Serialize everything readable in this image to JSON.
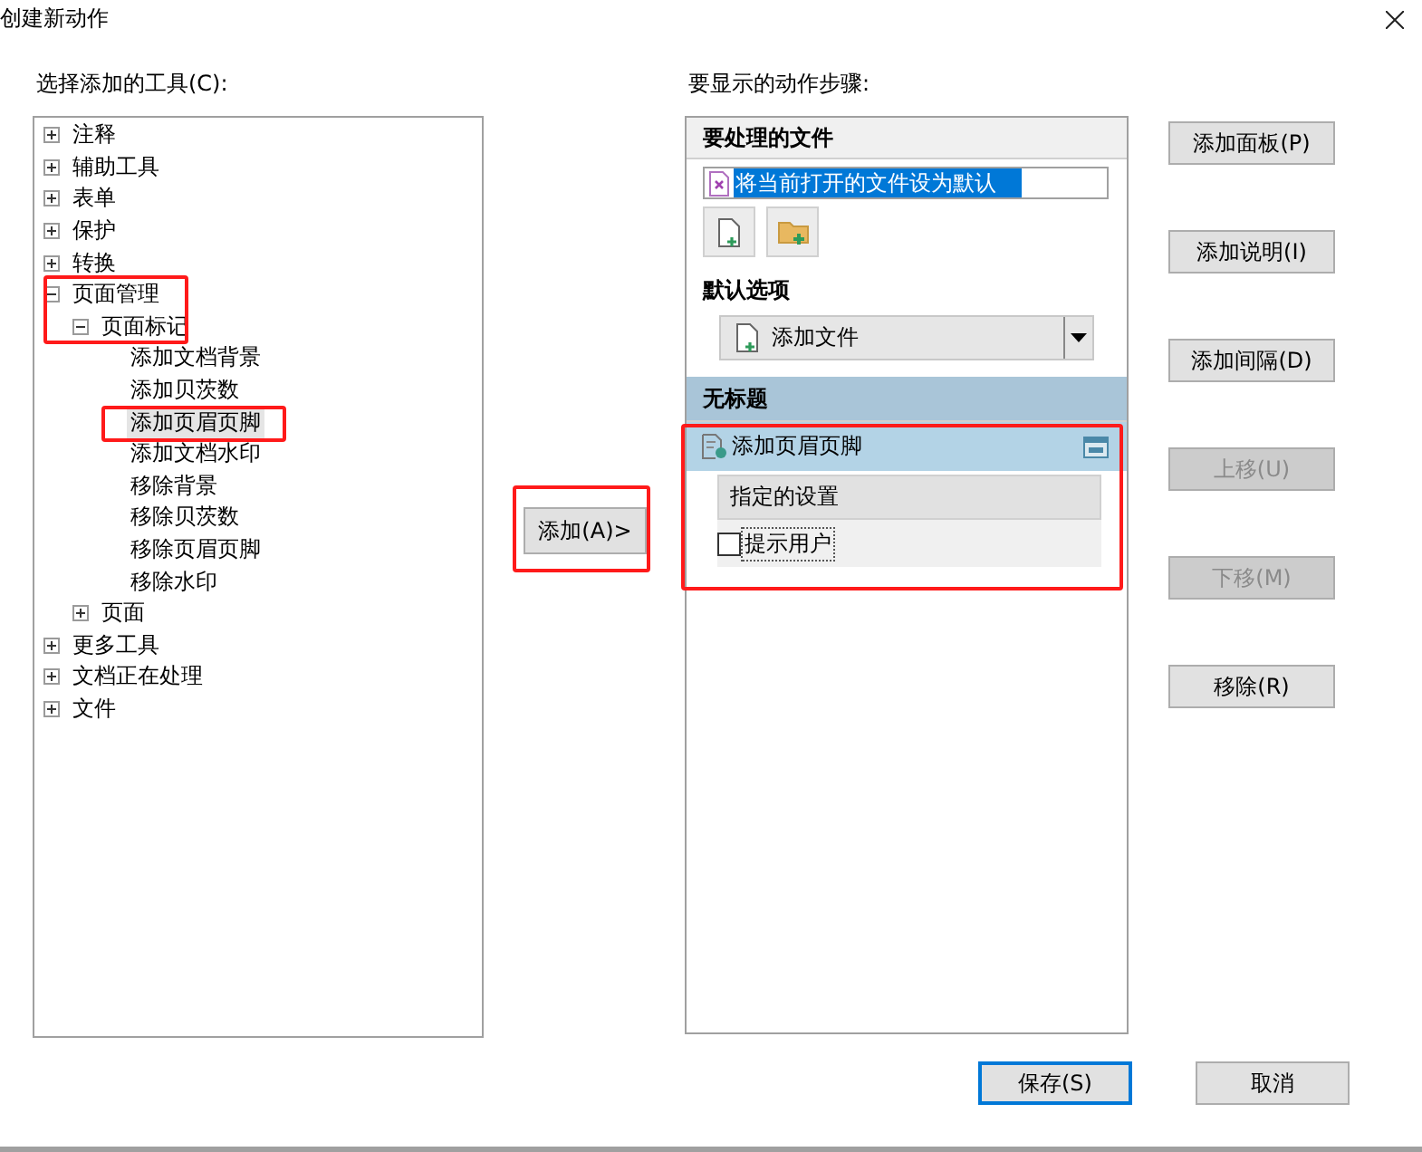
{
  "window": {
    "title": "创建新动作"
  },
  "tools_label": "选择添加的工具(C):",
  "tree": [
    {
      "label": "注释",
      "expanded": false
    },
    {
      "label": "辅助工具",
      "expanded": false
    },
    {
      "label": "表单",
      "expanded": false
    },
    {
      "label": "保护",
      "expanded": false
    },
    {
      "label": "转换",
      "expanded": false
    },
    {
      "label": "页面管理",
      "expanded": true,
      "children": [
        {
          "label": "页面标记",
          "expanded": true,
          "children": [
            {
              "label": "添加文档背景",
              "selected": false
            },
            {
              "label": "添加贝茨数",
              "selected": false
            },
            {
              "label": "添加页眉页脚",
              "selected": true
            },
            {
              "label": "添加文档水印",
              "selected": false
            },
            {
              "label": "移除背景",
              "selected": false
            },
            {
              "label": "移除贝茨数",
              "selected": false
            },
            {
              "label": "移除页眉页脚",
              "selected": false
            },
            {
              "label": "移除水印",
              "selected": false
            }
          ]
        },
        {
          "label": "页面",
          "expanded": false
        }
      ]
    },
    {
      "label": "更多工具",
      "expanded": false
    },
    {
      "label": "文档正在处理",
      "expanded": false
    },
    {
      "label": "文件",
      "expanded": false
    }
  ],
  "add_button": "添加(A)>",
  "steps_label": "要显示的动作步骤:",
  "file_section": {
    "title": "要处理的文件",
    "file": "将当前打开的文件设为默认"
  },
  "defaults": {
    "title": "默认选项",
    "dropdown": "添加文件"
  },
  "group": {
    "title": "无标题",
    "steps": [
      {
        "label": "添加页眉页脚",
        "settings": "指定的设置",
        "prompt": {
          "label": "提示用户",
          "checked": false
        }
      }
    ]
  },
  "side_buttons": [
    {
      "label": "添加面板(P)",
      "disabled": false
    },
    {
      "label": "添加说明(I)",
      "disabled": false
    },
    {
      "label": "添加间隔(D)",
      "disabled": false
    },
    {
      "label": "上移(U)",
      "disabled": true
    },
    {
      "label": "下移(M)",
      "disabled": true
    },
    {
      "label": "移除(R)",
      "disabled": false
    }
  ],
  "footer": [
    {
      "label": "保存(S)",
      "kind": "default"
    },
    {
      "label": "取消",
      "kind": "normal"
    }
  ]
}
